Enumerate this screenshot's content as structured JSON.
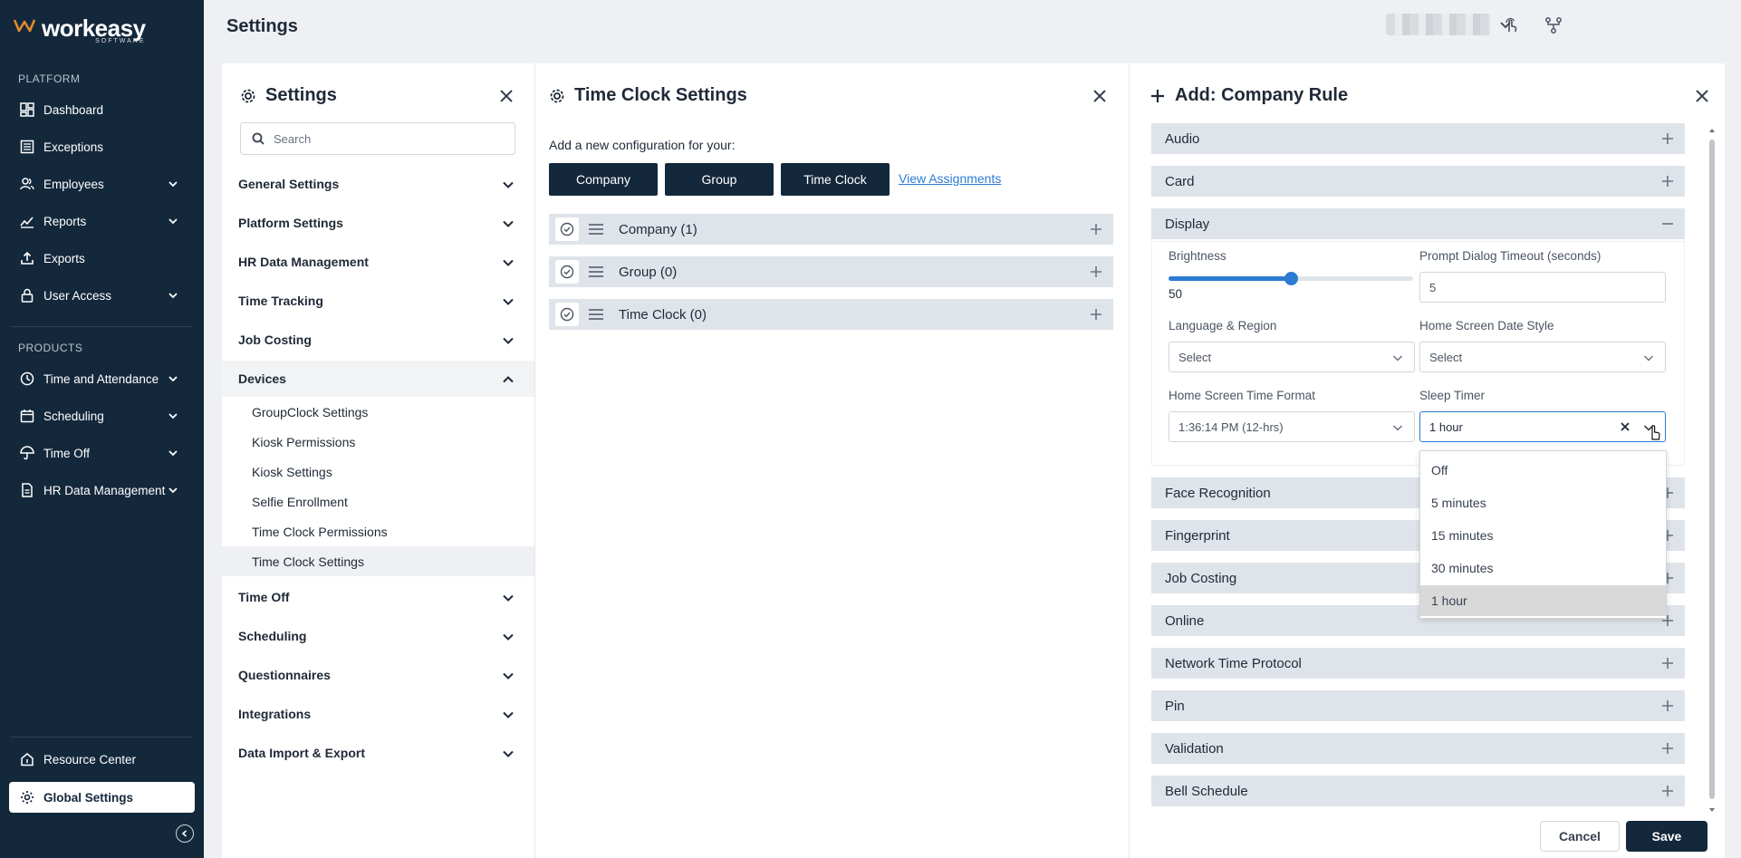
{
  "brand": {
    "name": "workeasy",
    "sub": "SOFTWARE"
  },
  "nav": {
    "platform_label": "PLATFORM",
    "platform_items": [
      {
        "label": "Dashboard"
      },
      {
        "label": "Exceptions"
      },
      {
        "label": "Employees"
      },
      {
        "label": "Reports"
      },
      {
        "label": "Exports"
      },
      {
        "label": "User Access"
      }
    ],
    "products_label": "PRODUCTS",
    "product_items": [
      {
        "label": "Time and Attendance"
      },
      {
        "label": "Scheduling"
      },
      {
        "label": "Time Off"
      },
      {
        "label": "HR Data Management"
      }
    ],
    "resource_center": "Resource Center",
    "global_settings": "Global Settings"
  },
  "header": {
    "title": "Settings"
  },
  "settings_panel": {
    "title": "Settings",
    "search_placeholder": "Search",
    "sections": [
      {
        "label": "General Settings"
      },
      {
        "label": "Platform Settings"
      },
      {
        "label": "HR Data Management"
      },
      {
        "label": "Time Tracking"
      },
      {
        "label": "Job Costing"
      },
      {
        "label": "Devices"
      },
      {
        "label": "Time Off"
      },
      {
        "label": "Scheduling"
      },
      {
        "label": "Questionnaires"
      },
      {
        "label": "Integrations"
      },
      {
        "label": "Data Import & Export"
      }
    ],
    "devices_items": [
      {
        "label": "GroupClock Settings"
      },
      {
        "label": "Kiosk Permissions"
      },
      {
        "label": "Kiosk Settings"
      },
      {
        "label": "Selfie Enrollment"
      },
      {
        "label": "Time Clock Permissions"
      },
      {
        "label": "Time Clock Settings"
      }
    ]
  },
  "timeclock_panel": {
    "title": "Time Clock Settings",
    "add_label": "Add a new configuration for your:",
    "buttons": [
      "Company",
      "Group",
      "Time Clock"
    ],
    "view_assignments": "View Assignments",
    "configs": [
      {
        "label": "Company (1)"
      },
      {
        "label": "Group (0)"
      },
      {
        "label": "Time Clock (0)"
      }
    ]
  },
  "rule_panel": {
    "title": "Add: Company Rule",
    "sections_top": [
      "Audio",
      "Card",
      "Display"
    ],
    "display": {
      "brightness_label": "Brightness",
      "brightness_value": "50",
      "brightness_fraction": 0.5,
      "prompt_label": "Prompt Dialog Timeout (seconds)",
      "prompt_value": "5",
      "language_label": "Language & Region",
      "language_placeholder": "Select",
      "date_style_label": "Home Screen Date Style",
      "date_style_placeholder": "Select",
      "time_format_label": "Home Screen Time Format",
      "time_format_value": "1:36:14 PM (12-hrs)",
      "sleep_label": "Sleep Timer",
      "sleep_value": "1 hour"
    },
    "sleep_options": [
      "Off",
      "5 minutes",
      "15 minutes",
      "30 minutes",
      "1 hour"
    ],
    "sections_bottom": [
      "Face Recognition",
      "Fingerprint",
      "Job Costing",
      "Online",
      "Network Time Protocol",
      "Pin",
      "Validation",
      "Bell Schedule"
    ],
    "cancel": "Cancel",
    "save": "Save"
  }
}
